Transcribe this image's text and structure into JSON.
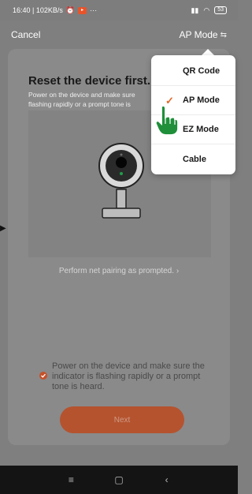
{
  "status_bar": {
    "time_speed": "16:40 | 102KB/s",
    "more": "···",
    "signal": "ᴴᵈ ill",
    "battery": "53"
  },
  "nav": {
    "cancel_label": "Cancel",
    "mode_label": "AP Mode"
  },
  "main": {
    "title": "Reset the device first.",
    "description_line1": "Power on the device and make sure",
    "description_line2": "flashing rapidly or a prompt tone is",
    "pairing_link": "Perform net pairing as prompted.",
    "confirm_text": "Power on the device and make sure the indicator is flashing rapidly or a prompt tone is heard.",
    "next_label": "Next"
  },
  "menu": {
    "items": [
      {
        "label": "QR Code",
        "selected": false
      },
      {
        "label": "AP Mode",
        "selected": true
      },
      {
        "label": "EZ Mode",
        "selected": false
      },
      {
        "label": "Cable",
        "selected": false
      }
    ]
  },
  "system_nav": {
    "menu_glyph": "≡",
    "home_glyph": "▢",
    "back_glyph": "‹"
  },
  "colors": {
    "accent": "#e36a2c",
    "button": "#b5532f",
    "hand": "#1f8f3a"
  },
  "icons": [
    "swap-icon",
    "check-icon",
    "camera-illustration",
    "pointing-hand-icon",
    "chevron-right-icon"
  ]
}
